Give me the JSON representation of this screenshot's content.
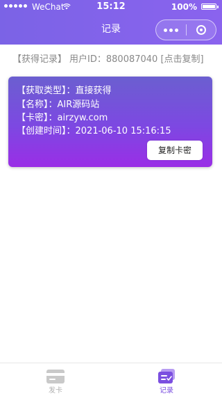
{
  "status_bar": {
    "carrier": "WeChat",
    "time": "15:12",
    "battery": "100%"
  },
  "nav": {
    "title": "记录"
  },
  "info": {
    "section_label": "【获得记录】",
    "user_id_label": "用户ID：",
    "user_id": "880087040",
    "copy_hint": "[点击复制]"
  },
  "record": {
    "type_label": "【获取类型】：",
    "type_value": "直接获得",
    "name_label": "【名称】：",
    "name_value": "AIR源码站",
    "key_label": "【卡密】：",
    "key_value": "airzyw.com",
    "created_label": "【创建时间】：",
    "created_value": "2021-06-10 15:16:15",
    "copy_button": "复制卡密"
  },
  "tabbar": {
    "tabs": [
      {
        "label": "发卡",
        "icon": "card-icon",
        "active": false
      },
      {
        "label": "记录",
        "icon": "record-list-icon",
        "active": true
      }
    ]
  },
  "colors": {
    "accent": "#7b63e6",
    "card_top": "#6b5fd0",
    "card_bottom": "#9a2ee6",
    "tab_active": "#7b4fe0",
    "tab_inactive": "#b0b0b0"
  }
}
